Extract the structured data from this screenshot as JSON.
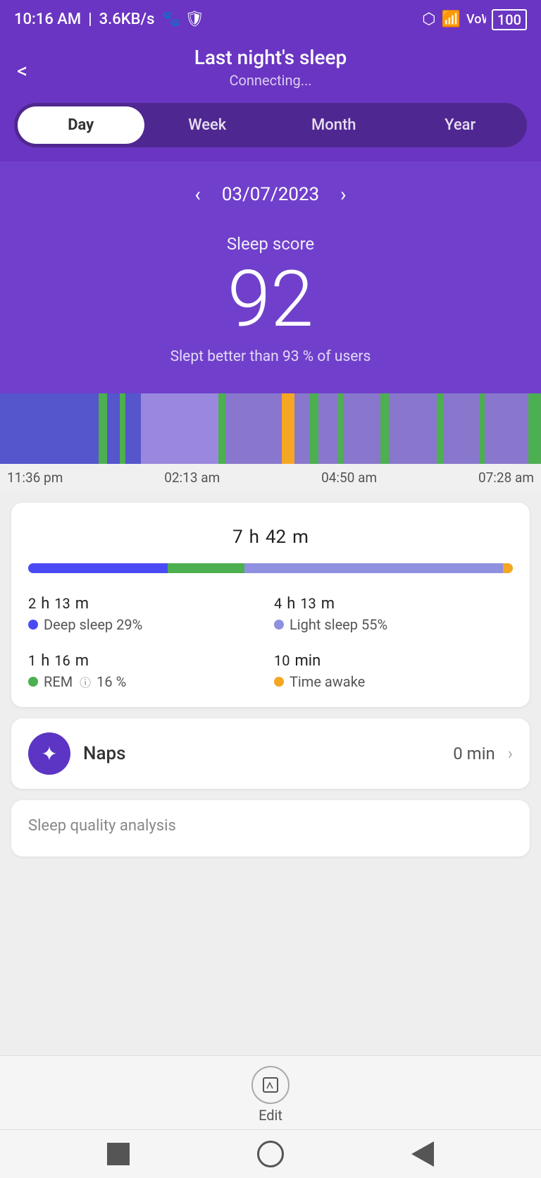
{
  "statusBar": {
    "time": "10:16 AM",
    "network": "3.6KB/s",
    "battery": "100"
  },
  "header": {
    "title": "Last night's sleep",
    "subtitle": "Connecting...",
    "backLabel": "<"
  },
  "tabs": {
    "items": [
      "Day",
      "Week",
      "Month",
      "Year"
    ],
    "active": "Day"
  },
  "dateNav": {
    "date": "03/07/2023",
    "prevArrow": "‹",
    "nextArrow": "›"
  },
  "sleepScore": {
    "label": "Sleep score",
    "value": "92",
    "subtext": "Slept better than 93 % of users"
  },
  "timeLabels": {
    "t1": "11:36 pm",
    "t2": "02:13 am",
    "t3": "04:50 am",
    "t4": "07:28 am"
  },
  "totalSleep": {
    "hours": "7",
    "hLabel": "h",
    "minutes": "42",
    "mLabel": "m"
  },
  "sleepStats": {
    "deepSleep": {
      "hours": "2",
      "hLabel": "h",
      "minutes": "13",
      "mLabel": "m",
      "label": "Deep sleep 29%"
    },
    "lightSleep": {
      "hours": "4",
      "hLabel": "h",
      "minutes": "13",
      "mLabel": "m",
      "label": "Light sleep 55%"
    },
    "rem": {
      "hours": "1",
      "hLabel": "h",
      "minutes": "16",
      "mLabel": "m",
      "label": "REM",
      "pct": "16 %"
    },
    "awake": {
      "value": "10",
      "unit": "min",
      "label": "Time awake"
    }
  },
  "naps": {
    "label": "Naps",
    "value": "0 min",
    "iconSymbol": "✦"
  },
  "analysis": {
    "title": "Sleep quality analysis"
  },
  "bottomBar": {
    "editLabel": "Edit"
  }
}
